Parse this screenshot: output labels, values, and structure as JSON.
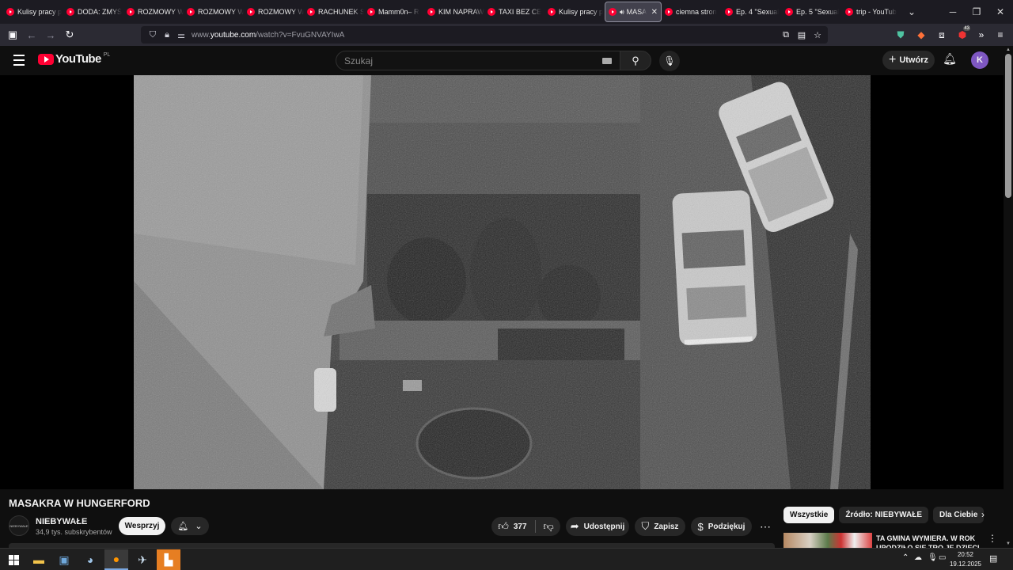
{
  "browser": {
    "tabs": [
      {
        "title": "Kulisy pracy p"
      },
      {
        "title": "DODA: ZMYŚ"
      },
      {
        "title": "ROZMOWY W"
      },
      {
        "title": "ROZMOWY W"
      },
      {
        "title": "ROZMOWY W"
      },
      {
        "title": "RACHUNEK S"
      },
      {
        "title": "Mamm0n– R"
      },
      {
        "title": "KIM NAPRAW"
      },
      {
        "title": "TAXI BEZ CE"
      },
      {
        "title": "Kulisy pracy p"
      },
      {
        "title": "MASA",
        "active": true
      },
      {
        "title": "ciemna stron"
      },
      {
        "title": "Ep. 4 \"Sexual"
      },
      {
        "title": "Ep. 5 \"Sexual"
      },
      {
        "title": "trip - YouTub"
      }
    ],
    "url_prefix": "www.",
    "url_domain": "youtube.com",
    "url_path": "/watch?v=FvuGNVAYIwA",
    "ext_badge": "43"
  },
  "youtube": {
    "logo_text": "YouTube",
    "country_code": "PL",
    "search_placeholder": "Szukaj",
    "create_label": "Utwórz",
    "avatar_letter": "K"
  },
  "video": {
    "title": "MASAKRA W HUNGERFORD",
    "channel_name": "NIEBYWAŁE",
    "channel_avatar_text": "NIEBYWAŁE",
    "subscribers": "34,9 tys. subskrybentów",
    "support_label": "Wesprzyj",
    "likes": "377",
    "share_label": "Udostępnij",
    "save_label": "Zapisz",
    "thanks_label": "Podziękuj"
  },
  "sidebar": {
    "chips": [
      "Wszystkie",
      "Źródło: NIEBYWAŁE",
      "Dla Ciebie"
    ],
    "recommendation_title": "TA GMINA WYMIERA. W ROK UPODZIŁO SIĘ TRO JE DZIECI"
  },
  "taskbar": {
    "time": "20:52",
    "date": "19.12.2025"
  },
  "colors": {
    "background": "#0f0f0f",
    "youtube_red": "#ff0033",
    "avatar": "#7e57c2",
    "browser_tabbar": "#1c1b22",
    "browser_navbar": "#2b2a33"
  }
}
